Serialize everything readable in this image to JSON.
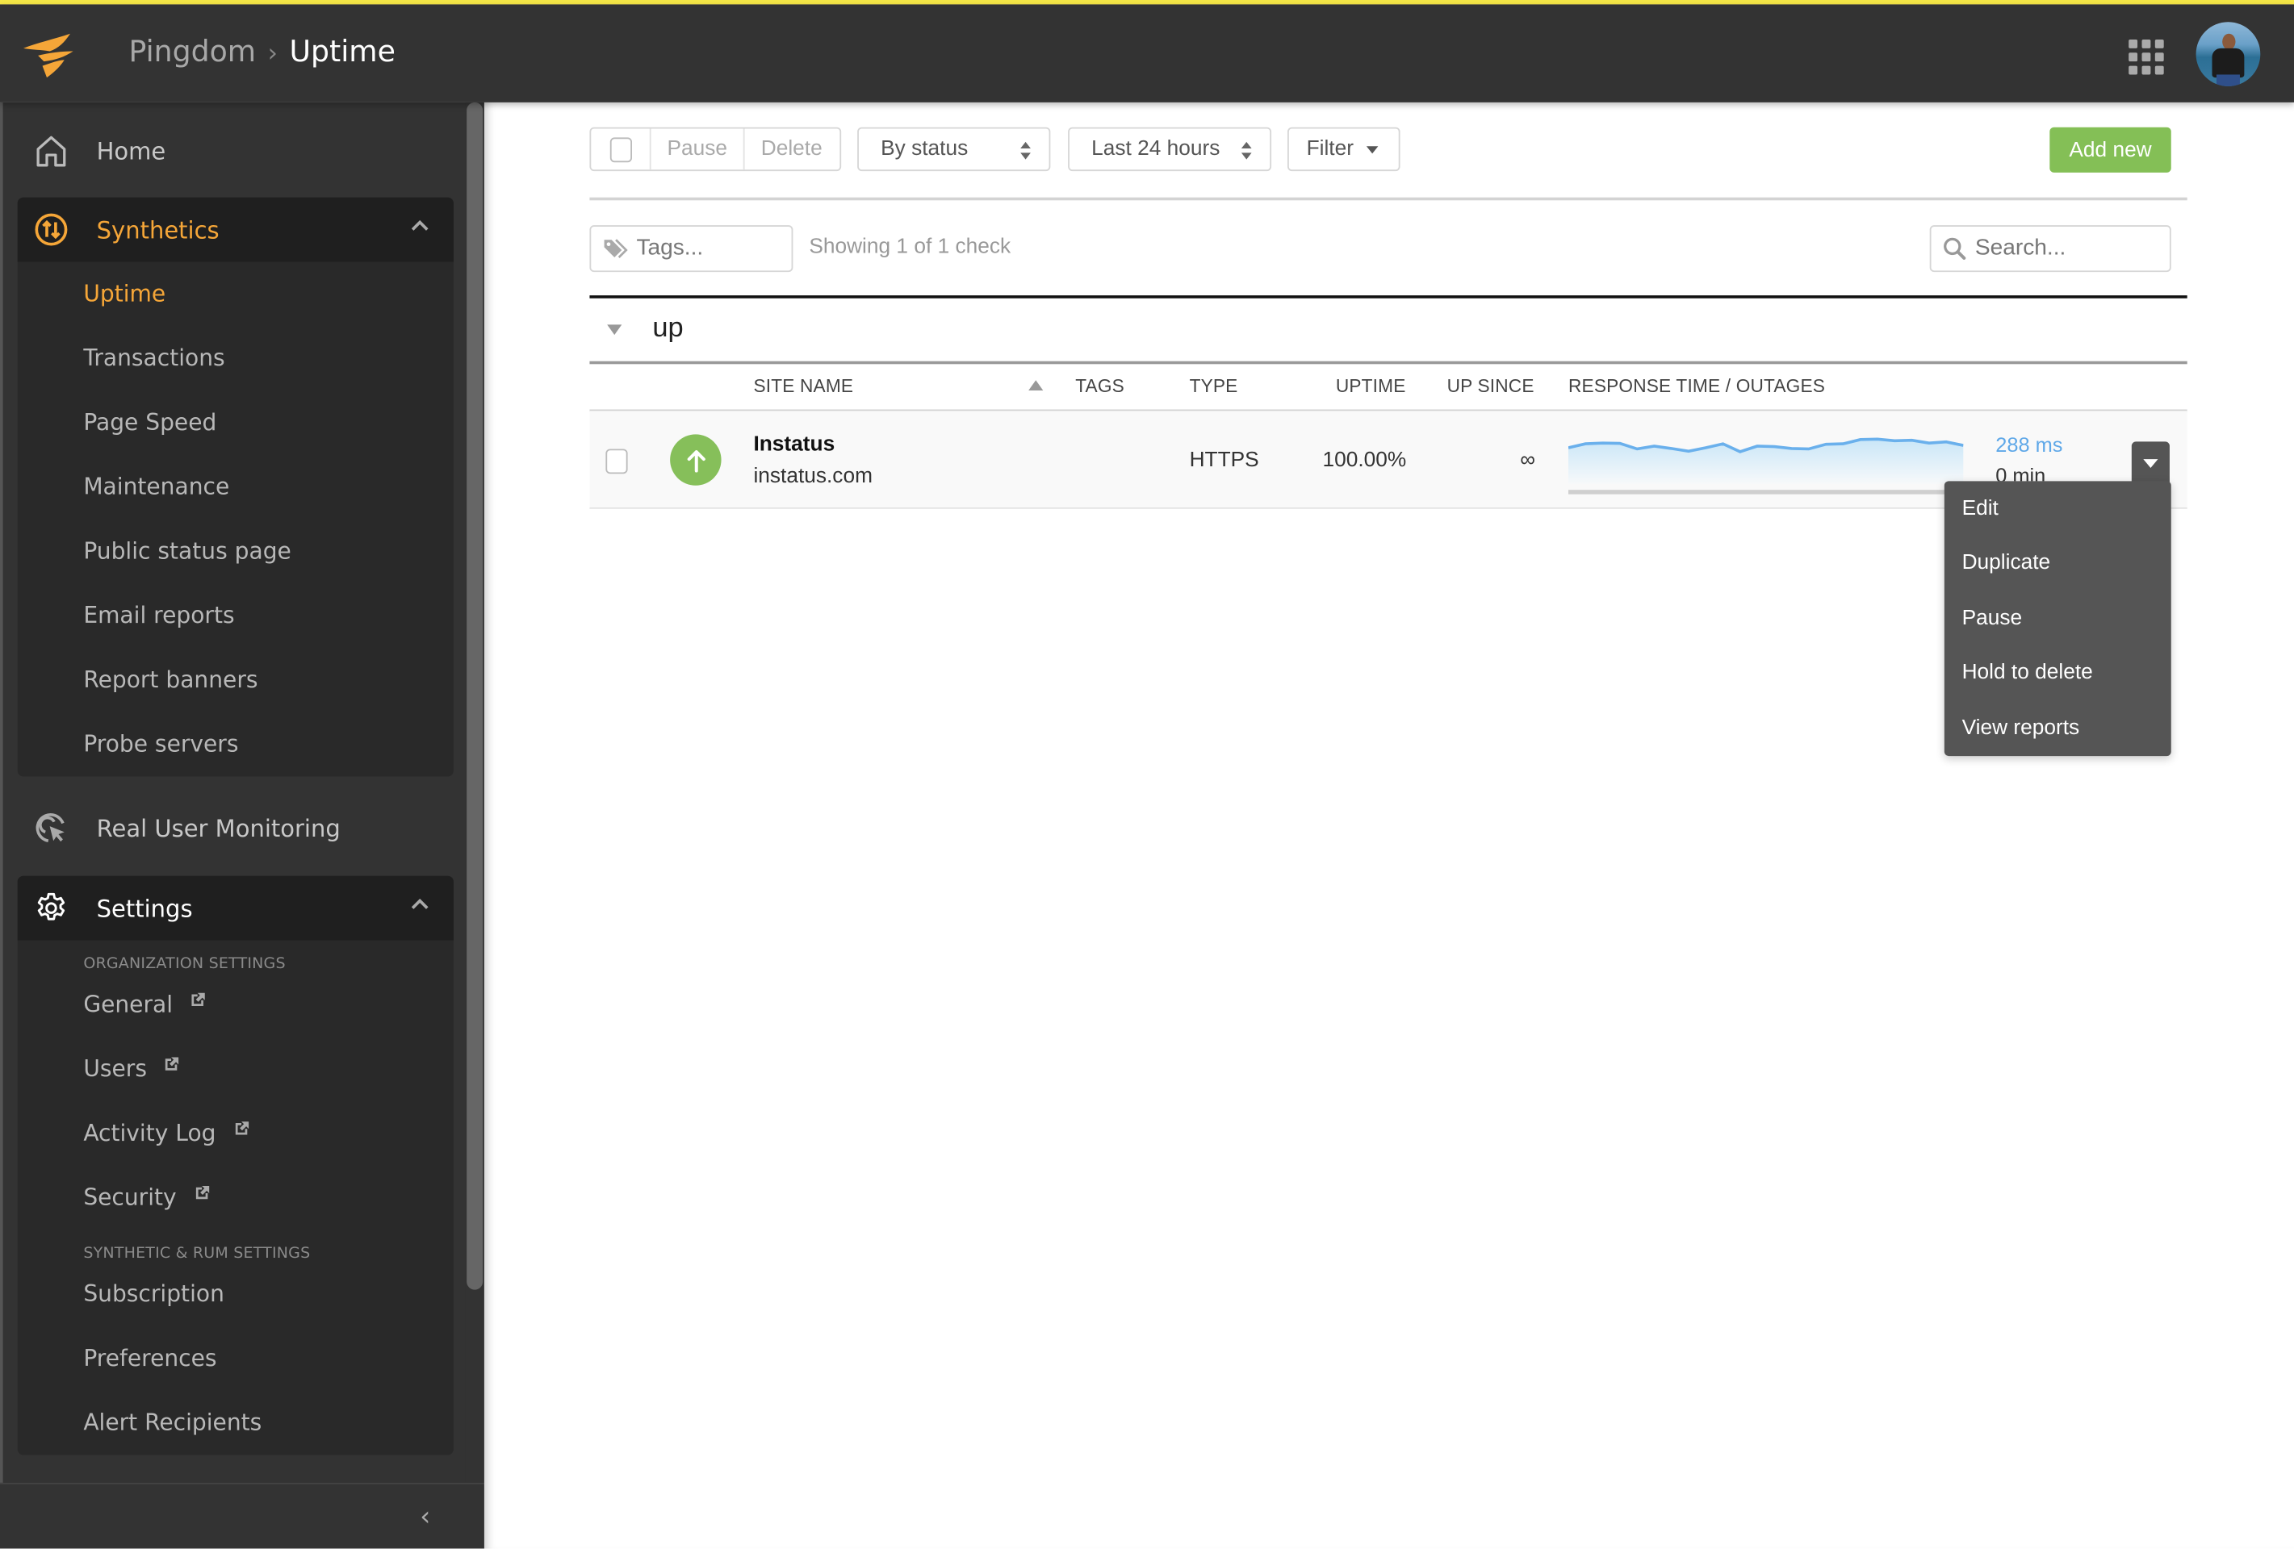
{
  "header": {
    "breadcrumb": [
      "Pingdom",
      "Uptime"
    ],
    "breadcrumb_separator": "›",
    "icons": {
      "logo": "solarwinds-flame-logo",
      "apps": "app-grid-icon",
      "avatar": "user-avatar"
    }
  },
  "colors": {
    "accent_orange": "#f5a638",
    "primary_green": "#84bf56",
    "status_up_green": "#86bf5a",
    "response_blue": "#5fa8e8",
    "top_stripe_yellow": "#f5e647",
    "header_bg": "#333333",
    "menu_bg": "#555555"
  },
  "sidebar": {
    "home": {
      "label": "Home",
      "icon": "home-icon"
    },
    "synthetics": {
      "label": "Synthetics",
      "icon": "synthetics-arrows-icon",
      "expanded": true,
      "items": [
        {
          "label": "Uptime",
          "active": true
        },
        {
          "label": "Transactions"
        },
        {
          "label": "Page Speed"
        },
        {
          "label": "Maintenance"
        },
        {
          "label": "Public status page"
        },
        {
          "label": "Email reports"
        },
        {
          "label": "Report banners"
        },
        {
          "label": "Probe servers"
        }
      ]
    },
    "rum": {
      "label": "Real User Monitoring",
      "icon": "rum-cursor-icon"
    },
    "settings": {
      "label": "Settings",
      "icon": "gear-icon",
      "expanded": true,
      "org_section_label": "ORGANIZATION SETTINGS",
      "org_items": [
        {
          "label": "General",
          "external": true
        },
        {
          "label": "Users",
          "external": true
        },
        {
          "label": "Activity Log",
          "external": true
        },
        {
          "label": "Security",
          "external": true
        }
      ],
      "synthetic_section_label": "SYNTHETIC & RUM SETTINGS",
      "synthetic_items": [
        {
          "label": "Subscription"
        },
        {
          "label": "Preferences"
        },
        {
          "label": "Alert Recipients"
        }
      ]
    },
    "collapse_glyph": "‹"
  },
  "toolbar": {
    "pause_label": "Pause",
    "delete_label": "Delete",
    "group_select": "By status",
    "time_select": "Last 24 hours",
    "filter_label": "Filter",
    "add_new_label": "Add new"
  },
  "filters": {
    "tags_placeholder": "Tags...",
    "tags_value": "",
    "showing_text": "Showing 1 of 1 check",
    "search_placeholder": "Search...",
    "search_value": ""
  },
  "table": {
    "group_name": "up",
    "columns": [
      "SITE NAME",
      "TAGS",
      "TYPE",
      "UPTIME",
      "UP SINCE",
      "RESPONSE TIME / OUTAGES"
    ],
    "sort": {
      "column": "SITE NAME",
      "direction": "ascending"
    },
    "rows": [
      {
        "status": "up",
        "name": "Instatus",
        "url": "instatus.com",
        "tags": "",
        "type": "HTTPS",
        "uptime": "100.00%",
        "up_since": "∞",
        "response_time": "288 ms",
        "outages": "0 min",
        "sparkline_relative": [
          0.55,
          0.72,
          0.75,
          0.74,
          0.5,
          0.62,
          0.52,
          0.4,
          0.55,
          0.72,
          0.38,
          0.62,
          0.6,
          0.52,
          0.5,
          0.7,
          0.72,
          0.9,
          0.92,
          0.85,
          0.87,
          0.75,
          0.8,
          0.65
        ]
      }
    ]
  },
  "row_menu": {
    "open": true,
    "items": [
      "Edit",
      "Duplicate",
      "Pause",
      "Hold to delete",
      "View reports"
    ]
  }
}
